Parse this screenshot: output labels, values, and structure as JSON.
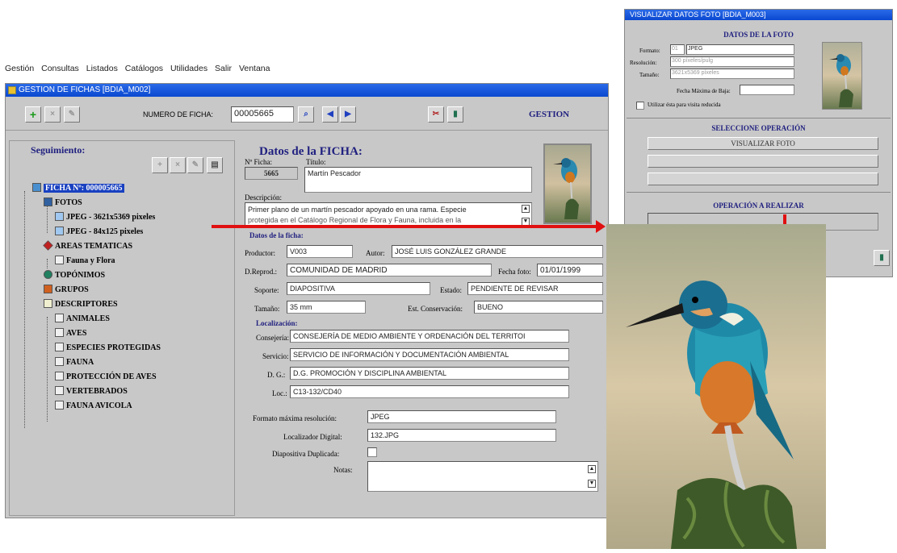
{
  "menu": [
    "Gestión",
    "Consultas",
    "Listados",
    "Catálogos",
    "Utilidades",
    "Salir",
    "Ventana"
  ],
  "main_window": {
    "title": "GESTION DE FICHAS [BDIA_M002]",
    "numero_label": "NUMERO DE FICHA:",
    "numero_value": "00005665",
    "gestion_label": "GESTION"
  },
  "seguimiento": {
    "title": "Seguimiento:",
    "tree": [
      {
        "label": "FICHA Nº: 000005665",
        "level": 0,
        "icon": "ficha-icon"
      },
      {
        "label": "FOTOS",
        "level": 1,
        "icon": "photos-icon"
      },
      {
        "label": "JPEG - 3621x5369 pixeles",
        "level": 2,
        "icon": "jpeg-file-icon"
      },
      {
        "label": "JPEG - 84x125 pixeles",
        "level": 2,
        "icon": "jpeg-file-icon"
      },
      {
        "label": "AREAS TEMATICAS",
        "level": 1,
        "icon": "diamond-icon"
      },
      {
        "label": "Fauna y Flora",
        "level": 2,
        "icon": "document-icon"
      },
      {
        "label": "TOPÓNIMOS",
        "level": 1,
        "icon": "globe-icon"
      },
      {
        "label": "GRUPOS",
        "level": 1,
        "icon": "groups-icon"
      },
      {
        "label": "DESCRIPTORES",
        "level": 1,
        "icon": "descriptors-icon"
      },
      {
        "label": "ANIMALES",
        "level": 2,
        "icon": "document-icon"
      },
      {
        "label": "AVES",
        "level": 2,
        "icon": "document-icon"
      },
      {
        "label": "ESPECIES PROTEGIDAS",
        "level": 2,
        "icon": "document-icon"
      },
      {
        "label": "FAUNA",
        "level": 2,
        "icon": "document-icon"
      },
      {
        "label": "PROTECCIÓN DE AVES",
        "level": 2,
        "icon": "document-icon"
      },
      {
        "label": "VERTEBRADOS",
        "level": 2,
        "icon": "document-icon"
      },
      {
        "label": "FAUNA AVICOLA",
        "level": 2,
        "icon": "document-icon"
      }
    ]
  },
  "datos": {
    "title": "Datos de la FICHA:",
    "nficha_label": "Nº Ficha:",
    "nficha_value": "5665",
    "titulo_label": "Título:",
    "titulo_value": "Martín Pescador",
    "descripcion_label": "Descripción:",
    "descripcion_line1": "Primer plano de un martín pescador apoyado en una rama. Especie",
    "descripcion_line2": "protegida en el Catálogo Regional de Flora y Fauna, incluida en la",
    "ficha_section": "Datos de la ficha:",
    "productor_label": "Productor:",
    "productor_value": "V003",
    "autor_label": "Autor:",
    "autor_value": "JOSÉ LUIS GONZÁLEZ GRANDE",
    "dreprod_label": "D.Reprod.:",
    "dreprod_value": "COMUNIDAD DE MADRID",
    "fecha_label": "Fecha foto:",
    "fecha_value": "01/01/1999",
    "soporte_label": "Soporte:",
    "soporte_value": "DIAPOSITIVA",
    "estado_label": "Estado:",
    "estado_value": "PENDIENTE DE REVISAR",
    "tamano_label": "Tamaño:",
    "tamano_value": "35 mm",
    "conservacion_label": "Est. Conservación:",
    "conservacion_value": "BUENO",
    "localizacion_label": "Localización:",
    "consejeria_label": "Consejería:",
    "consejeria_value": "CONSEJERÍA DE MEDIO AMBIENTE Y ORDENACIÓN DEL TERRITOI",
    "servicio_label": "Servicio:",
    "servicio_value": "SERVICIO DE INFORMACIÓN Y DOCUMENTACIÓN AMBIENTAL",
    "dg_label": "D. G.:",
    "dg_value": "D.G. PROMOCIÓN Y DISCIPLINA AMBIENTAL",
    "loc_label": "Loc.:",
    "loc_value": "C13-132/CD40",
    "formato_label": "Formato máxima resolución:",
    "formato_value": "JPEG",
    "localizador_label": "Localizador Digital:",
    "localizador_value": "132.JPG",
    "duplicada_label": "Diapositiva Duplicada:",
    "notas_label": "Notas:"
  },
  "visualizar": {
    "title": "VISUALIZAR DATOS FOTO [BDIA_M003]",
    "datos_title": "DATOS DE LA FOTO",
    "formato_label": "Formato:",
    "formato_num": "01",
    "formato_value": "JPEG",
    "resolucion_label": "Resolución:",
    "resolucion_value": "300 píxeles/pulg",
    "tamano_label": "Tamaño:",
    "tamano_value": "3621x5369 píxeles",
    "fecha_baja_label": "Fecha Máxima de Baja:",
    "checkbox_label": "Utilizar ésta para visita reducida",
    "seleccione_title": "SELECCIONE OPERACIÓN",
    "op1": "VISUALIZAR FOTO",
    "operacion_title": "OPERACIÓN A REALIZAR"
  },
  "colors": {
    "title_bar": "#0a48d0",
    "arrow": "#e01010",
    "window_bg": "#c8c8c8"
  }
}
